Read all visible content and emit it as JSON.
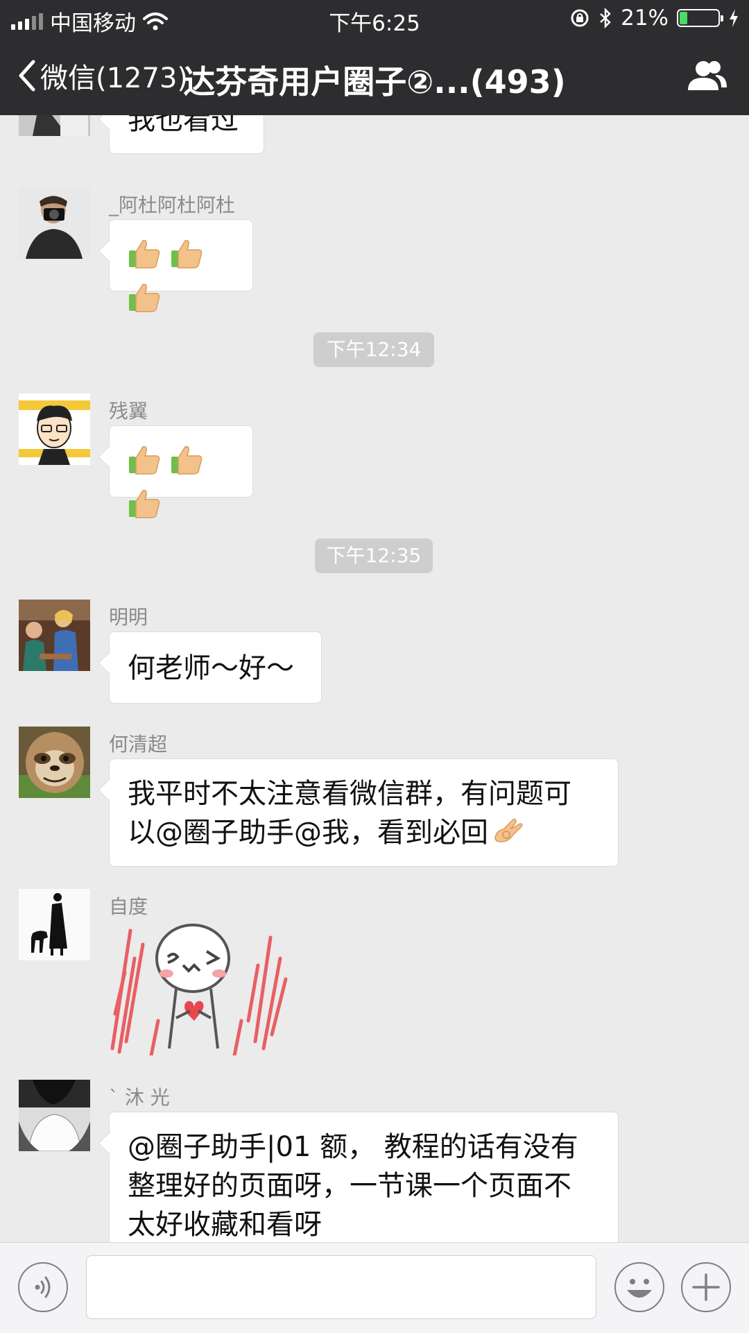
{
  "status_bar": {
    "carrier": "中国移动",
    "time": "下午6:25",
    "battery_percent": "21%",
    "battery_level": 0.21
  },
  "nav": {
    "back_label": "微信(1273)",
    "title": "达芬奇用户圈子②...(493)"
  },
  "messages": [
    {
      "type": "text",
      "sender": "",
      "text": "我也看过"
    },
    {
      "type": "emoji",
      "sender": "_阿杜阿杜阿杜",
      "emoji": [
        "thumbs-up",
        "thumbs-up",
        "thumbs-up"
      ]
    },
    {
      "type": "timestamp",
      "text": "下午12:34"
    },
    {
      "type": "emoji",
      "sender": "残翼",
      "emoji": [
        "thumbs-up",
        "thumbs-up",
        "thumbs-up"
      ]
    },
    {
      "type": "timestamp",
      "text": "下午12:35"
    },
    {
      "type": "text",
      "sender": "明明",
      "text": "何老师～好～"
    },
    {
      "type": "text",
      "sender": "何清超",
      "lines": [
        "我平时不太注意看微信群，有问题可",
        "以@圈子助手@我，看到必回"
      ],
      "trailing_emoji": "ok-hand"
    },
    {
      "type": "sticker",
      "sender": "自度",
      "sticker": "blushing-face-sticker"
    },
    {
      "type": "text",
      "sender": "` 沐 光",
      "lines": [
        "@圈子助手|01 额， 教程的话有没有",
        "整理好的页面呀，一节课一个页面不",
        "太好收藏和看呀"
      ]
    }
  ],
  "input_bar": {
    "voice_icon": "voice-icon",
    "emoji_icon": "emoji-icon",
    "more_icon": "plus-icon",
    "text_value": ""
  },
  "colors": {
    "nav_bg": "#2d2d30",
    "chat_bg": "#ebebeb",
    "bubble_bg": "#ffffff",
    "timestamp_bg": "#cecece",
    "battery_fill": "#4cd964"
  }
}
